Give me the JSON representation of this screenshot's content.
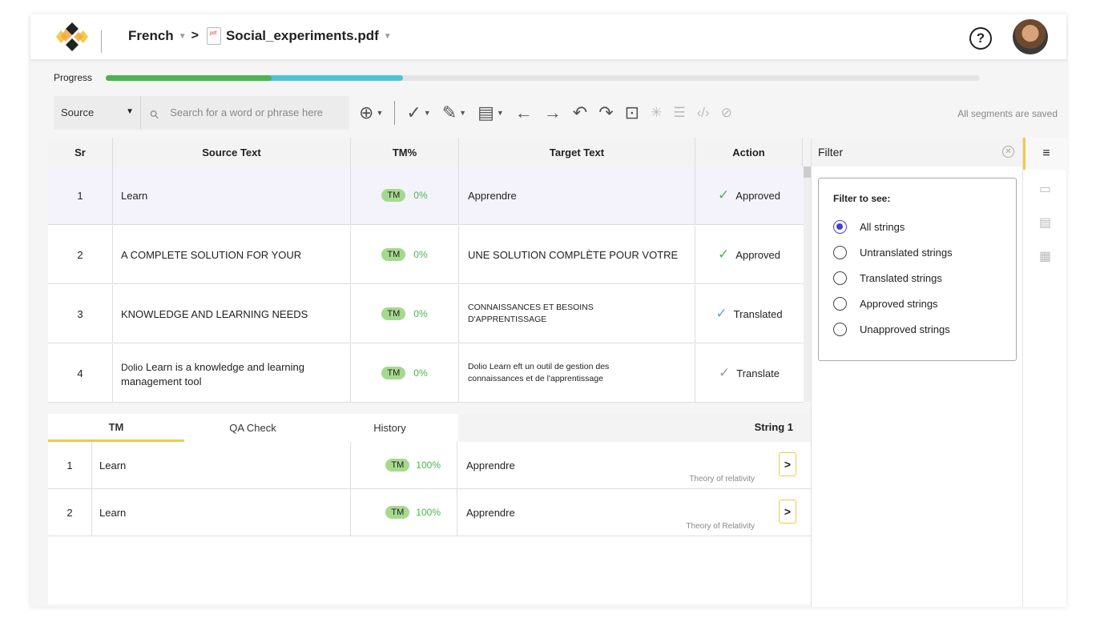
{
  "header": {
    "language": "French",
    "filename": "Social_experiments.pdf",
    "pdf_badge": "pdf",
    "help_label": "?"
  },
  "progress": {
    "label": "Progress",
    "approved_fraction": 0.19,
    "translated_fraction": 0.34
  },
  "toolbar": {
    "source_value": "Source",
    "search_placeholder": "Search for a word or phrase here",
    "status": "All segments are saved"
  },
  "table": {
    "columns": [
      "Sr",
      "Source Text",
      "TM%",
      "Target Text",
      "Action"
    ],
    "rows": [
      {
        "sr": "1",
        "source": "Learn",
        "tm": "TM",
        "pct": "0%",
        "target": "Apprendre",
        "action": "Approved"
      },
      {
        "sr": "2",
        "source": "A COMPLETE SOLUTION FOR YOUR",
        "tm": "TM",
        "pct": "0%",
        "target": "UNE SOLUTION COMPLÈTE POUR VOTRE",
        "action": "Approved"
      },
      {
        "sr": "3",
        "source": "KNOWLEDGE AND LEARNING NEEDS",
        "tm": "TM",
        "pct": "0%",
        "target": "CONNAISSANCES ET BESOINS D'APPRENTISSAGE",
        "action": "Translated"
      },
      {
        "sr": "4",
        "source_prefix": "Dolio",
        "source": "Learn is a knowledge and learning management tool",
        "tm": "TM",
        "pct": "0%",
        "target": "Dolio Learn eft un outil de gestion des connaissances et de l'apprentissage",
        "action": "Translate"
      }
    ]
  },
  "bottom": {
    "tabs": [
      "TM",
      "QA Check",
      "History"
    ],
    "string_label": "String 1",
    "rows": [
      {
        "sr": "1",
        "source": "Learn",
        "tm": "TM",
        "pct": "100%",
        "target": "Apprendre",
        "sub": "Theory of relativity"
      },
      {
        "sr": "2",
        "source": "Learn",
        "tm": "TM",
        "pct": "100%",
        "target": "Apprendre",
        "sub": "Theory of Relativity"
      }
    ]
  },
  "filter": {
    "title": "Filter",
    "box_title": "Filter to see:",
    "options": [
      "All strings",
      "Untranslated strings",
      "Translated strings",
      "Approved strings",
      "Unapproved strings"
    ],
    "selected": "All strings"
  },
  "icons": [
    "filter-icon",
    "comment-icon",
    "note-icon",
    "calculator-icon"
  ]
}
